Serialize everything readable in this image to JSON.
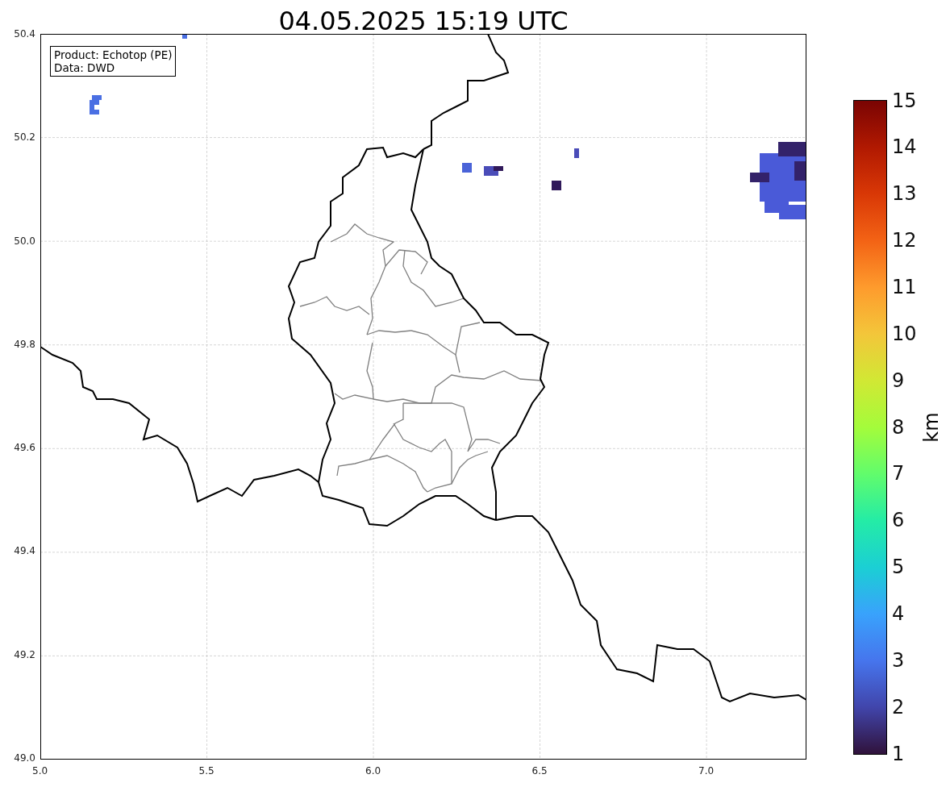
{
  "title": "04.05.2025 15:19 UTC",
  "info_box": [
    "Product: Echotop (PE)",
    "Data: DWD"
  ],
  "map": {
    "xticks": [
      "5.0",
      "5.5",
      "6.0",
      "6.5",
      "7.0"
    ],
    "yticks": [
      "50.4",
      "50.2",
      "50.0",
      "49.8",
      "49.6",
      "49.4",
      "49.2",
      "49.0"
    ]
  },
  "colorbar": {
    "label": "km",
    "ticks": [
      "15",
      "14",
      "13",
      "12",
      "11",
      "10",
      "9",
      "8",
      "7",
      "6",
      "5",
      "4",
      "3",
      "2",
      "1"
    ]
  }
}
